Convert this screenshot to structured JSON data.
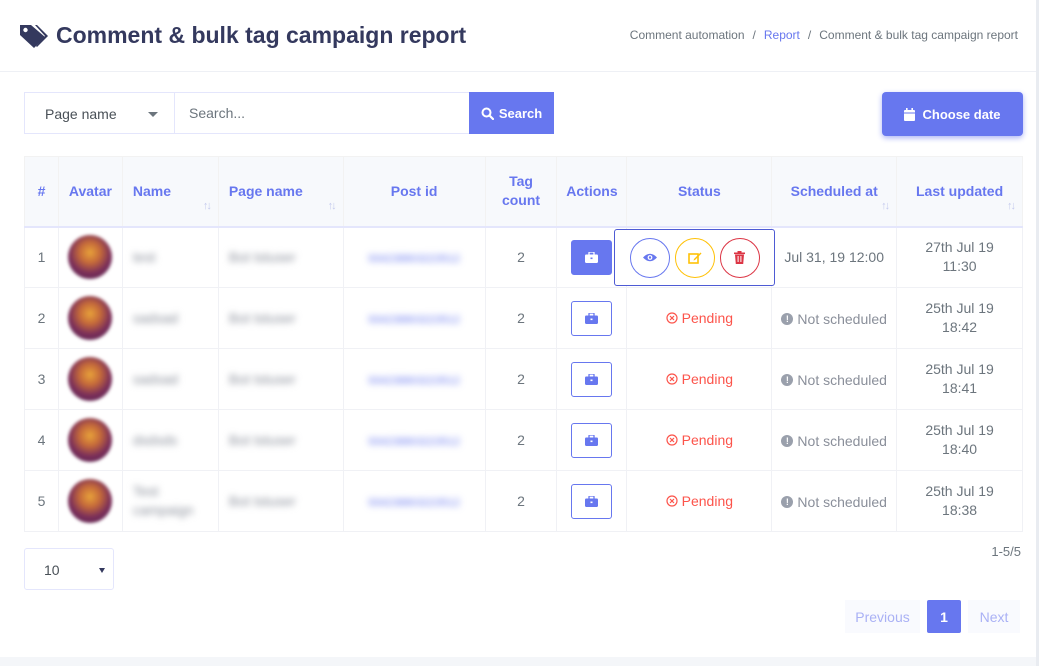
{
  "header": {
    "title": "Comment & bulk tag campaign report",
    "breadcrumb": [
      "Comment automation",
      "Report",
      "Comment & bulk tag campaign report"
    ]
  },
  "filters": {
    "page_select_value": "Page name",
    "search_placeholder": "Search...",
    "search_button": "Search",
    "date_button": "Choose date"
  },
  "table": {
    "columns": [
      "#",
      "Avatar",
      "Name",
      "Page name",
      "Post id",
      "Tag count",
      "Actions",
      "Status",
      "Scheduled at",
      "Last updated"
    ],
    "rows": [
      {
        "num": "1",
        "name": "test",
        "page": "Bot tstuser",
        "post_id": "934238803223512",
        "tag_count": "2",
        "status": "",
        "scheduled": "Jul 31, 19 12:00",
        "updated_date": "27th Jul 19",
        "updated_time": "11:30"
      },
      {
        "num": "2",
        "name": "sadsad",
        "page": "Bot tstuser",
        "post_id": "934238803223512",
        "tag_count": "2",
        "status": "Pending",
        "scheduled": "Not scheduled",
        "updated_date": "25th Jul 19",
        "updated_time": "18:42"
      },
      {
        "num": "3",
        "name": "sadsad",
        "page": "Bot tstuser",
        "post_id": "934238803223512",
        "tag_count": "2",
        "status": "Pending",
        "scheduled": "Not scheduled",
        "updated_date": "25th Jul 19",
        "updated_time": "18:41"
      },
      {
        "num": "4",
        "name": "dsdsds",
        "page": "Bot tstuser",
        "post_id": "934238803223512",
        "tag_count": "2",
        "status": "Pending",
        "scheduled": "Not scheduled",
        "updated_date": "25th Jul 19",
        "updated_time": "18:40"
      },
      {
        "num": "5",
        "name": "Test campaign",
        "page": "Bot tstuser",
        "post_id": "934238803223512",
        "tag_count": "2",
        "status": "Pending",
        "scheduled": "Not scheduled",
        "updated_date": "25th Jul 19",
        "updated_time": "18:38"
      }
    ]
  },
  "footer": {
    "per_page": "10",
    "range": "1-5/5",
    "prev": "Previous",
    "page": "1",
    "next": "Next"
  },
  "colors": {
    "accent": "#6777ef",
    "title": "#34395e",
    "danger": "#fc544b",
    "warning": "#ffc107"
  },
  "icons": [
    "tags-icon",
    "search-icon",
    "calendar-icon",
    "briefcase-icon",
    "eye-icon",
    "edit-icon",
    "trash-icon",
    "times-circle-icon",
    "info-circle-icon"
  ]
}
